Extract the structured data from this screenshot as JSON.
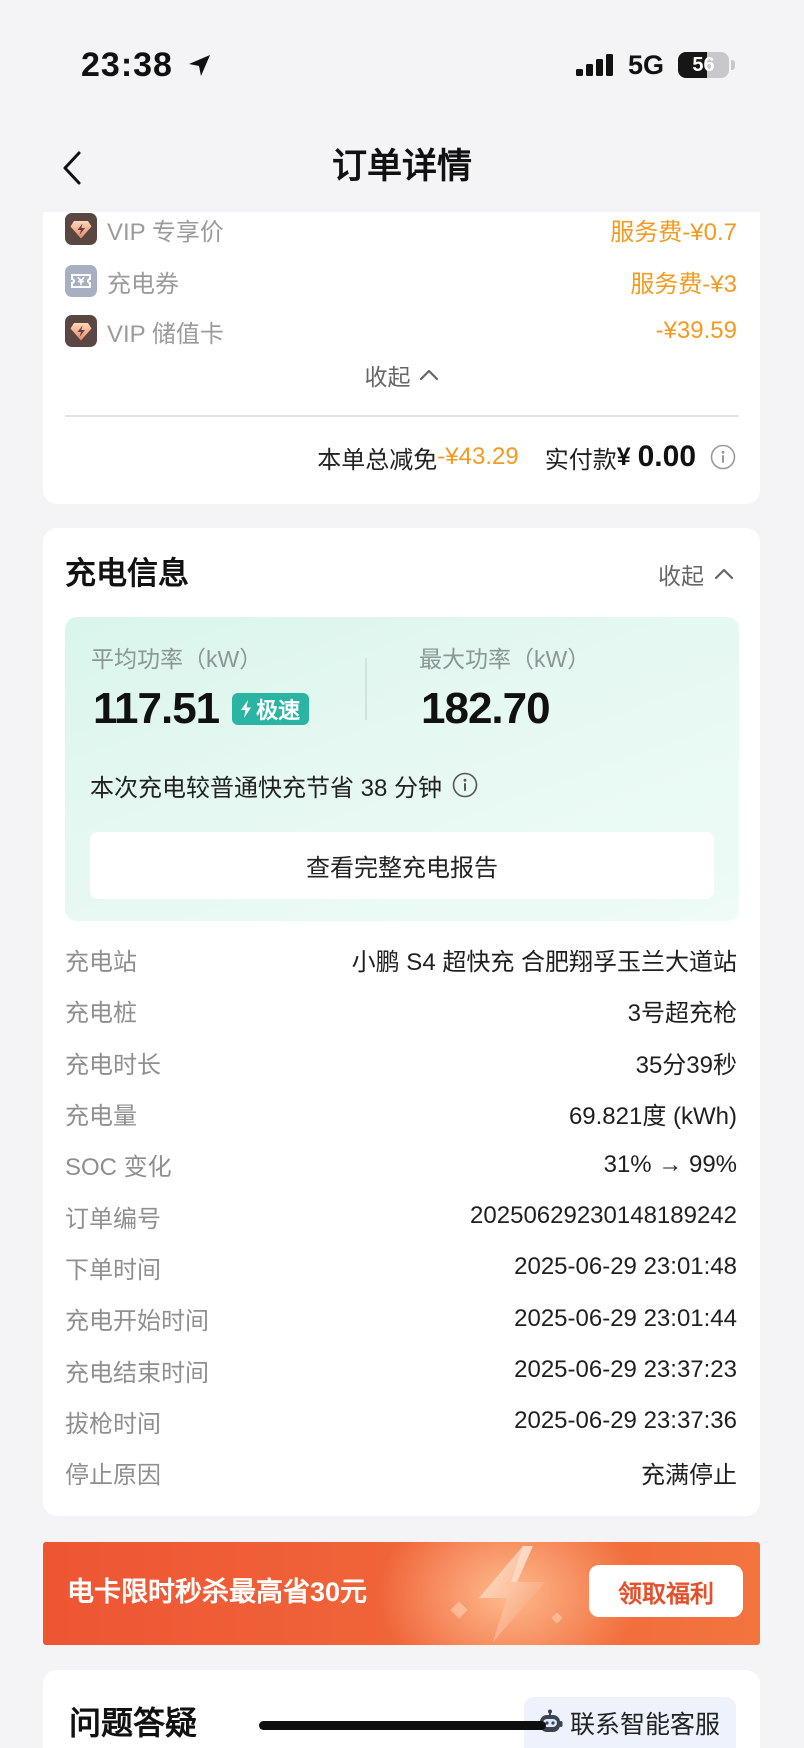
{
  "status_bar": {
    "time": "23:38",
    "network": "5G",
    "battery": "56",
    "signal_bars": 4
  },
  "nav": {
    "title": "订单详情"
  },
  "discounts": {
    "items": [
      {
        "icon": "vip-gem-icon",
        "label": "VIP 专享价",
        "value": "服务费-¥0.7"
      },
      {
        "icon": "coupon-icon",
        "label": "充电券",
        "value": "服务费-¥3"
      },
      {
        "icon": "vip-gem-icon",
        "label": "VIP 储值卡",
        "value": "-¥39.59"
      }
    ],
    "collapse_label": "收起",
    "total_discount_label": "本单总减免",
    "total_discount_value": "-¥43.29",
    "paid_label": "实付款",
    "paid_currency": "¥",
    "paid_value": "0.00"
  },
  "charging": {
    "title": "充电信息",
    "collapse_label": "收起",
    "avg_power_label": "平均功率（kW）",
    "avg_power_value": "117.51",
    "speed_badge": "极速",
    "max_power_label": "最大功率（kW）",
    "max_power_value": "182.70",
    "saving_text": "本次充电较普通快充节省 38 分钟",
    "report_button": "查看完整充电报告",
    "details": [
      {
        "label": "充电站",
        "value": "小鹏 S4 超快充 合肥翔孚玉兰大道站"
      },
      {
        "label": "充电桩",
        "value": "3号超充枪"
      },
      {
        "label": "充电时长",
        "value": "35分39秒"
      },
      {
        "label": "充电量",
        "value": "69.821度 (kWh)"
      },
      {
        "label": "SOC 变化",
        "value": "31% → 99%"
      },
      {
        "label": "订单编号",
        "value": "20250629230148189242"
      },
      {
        "label": "下单时间",
        "value": "2025-06-29 23:01:48"
      },
      {
        "label": "充电开始时间",
        "value": "2025-06-29 23:01:44"
      },
      {
        "label": "充电结束时间",
        "value": "2025-06-29 23:37:23"
      },
      {
        "label": "拔枪时间",
        "value": "2025-06-29 23:37:36"
      },
      {
        "label": "停止原因",
        "value": "充满停止"
      }
    ]
  },
  "promo_banner": {
    "text": "电卡限时秒杀最高省30元",
    "button": "领取福利"
  },
  "faq": {
    "title": "问题答疑",
    "contact_button": "联系智能客服"
  },
  "colors": {
    "accent_orange": "#F39A1F",
    "speed_badge": "#2AB5A3",
    "banner": "#EF5A35",
    "banner_button_text": "#E4502B",
    "page_background": "#F4F4F6",
    "card": "#FFFFFF"
  }
}
